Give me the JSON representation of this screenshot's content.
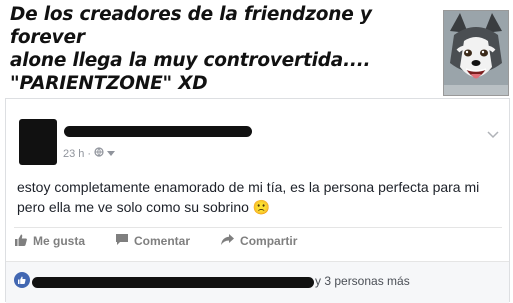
{
  "meme": {
    "caption": "De los creadores de la friendzone y forever\nalone llega la muy controvertida....\n\"PARIENTZONE\" XD"
  },
  "post": {
    "timestamp": "23 h",
    "separator": "·",
    "text": "estoy completamente enamorado de mi tía, es la persona perfecta para mi\npero ella me ve solo como su sobrino 🙁"
  },
  "actions": {
    "like_label": "Me gusta",
    "comment_label": "Comentar",
    "share_label": "Compartir"
  },
  "reactions": {
    "others_text": "y 3 personas más"
  },
  "colors": {
    "facebook_blue": "#4267b2",
    "muted_gray": "#90949c",
    "card_border": "#dddfe2"
  },
  "icons": {
    "privacy": "globe-icon",
    "menu": "chevron-down-icon",
    "like": "thumbs-up-icon",
    "comment": "comment-icon",
    "share": "share-arrow-icon"
  }
}
